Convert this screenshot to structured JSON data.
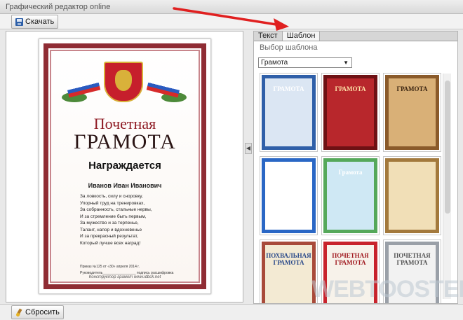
{
  "window": {
    "title": "Графический редактор online"
  },
  "toolbar": {
    "download_label": "Скачать"
  },
  "footer": {
    "reset_label": "Сбросить"
  },
  "tabs": [
    {
      "label": "Текст"
    },
    {
      "label": "Шаблон"
    }
  ],
  "template_panel": {
    "section_title": "Выбор шаблона",
    "selected_category": "Грамота",
    "thumbnails": [
      {
        "label": "ГРАМОТА",
        "bg": "#dbe6f3",
        "frame": "#2f5fa8",
        "label_color": "#ffffff"
      },
      {
        "label": "ГРАМОТА",
        "bg": "#b8272c",
        "frame": "#6e1114",
        "label_color": "#ffe3a8"
      },
      {
        "label": "ГРАМОТА",
        "bg": "#d9b077",
        "frame": "#8a5a2a",
        "label_color": "#3a2410"
      },
      {
        "label": "",
        "bg": "#ffffff",
        "frame": "#2a67c5",
        "label_color": "#c42020"
      },
      {
        "label": "Грамота",
        "bg": "#cfe8f4",
        "frame": "#55a85a",
        "label_color": "#ffffff"
      },
      {
        "label": "",
        "bg": "#f1dfb7",
        "frame": "#a3793c",
        "label_color": "#6a4a1a"
      },
      {
        "label": "ПОХВАЛЬНАЯ ГРАМОТА",
        "bg": "#f3ead3",
        "frame": "#a84a3a",
        "label_color": "#2a4a8a"
      },
      {
        "label": "ПОЧЕТНАЯ ГРАМОТА",
        "bg": "#f7f2ea",
        "frame": "#c8232c",
        "label_color": "#a0181e"
      },
      {
        "label": "ПОЧЕТНАЯ ГРАМОТА",
        "bg": "#f2f2f2",
        "frame": "#9aa0a8",
        "label_color": "#555555"
      }
    ]
  },
  "certificate": {
    "title_line1": "Почетная",
    "title_line2": "ГРАМОТА",
    "award_text": "Награждается",
    "recipient": "Иванов Иван Иванович",
    "lines": [
      "За ловкость, силу и сноровку,",
      "Упорный труд на тренировках,",
      "За собранность, стальные нервы,",
      "И за стремление быть первым,",
      "За мужество и за терпенье,",
      "Талант, напор и вдохновенье",
      "И за прекрасный результат,",
      "Который лучше всех наград!"
    ],
    "order_line": "Приказ №125 от «30» апреля 2014 г.",
    "signature_line": "Руководитель_________________ подпись расшифровка",
    "website": "Конструктор грамот www.idbck.net"
  },
  "watermark": "WEBTOOSTER"
}
